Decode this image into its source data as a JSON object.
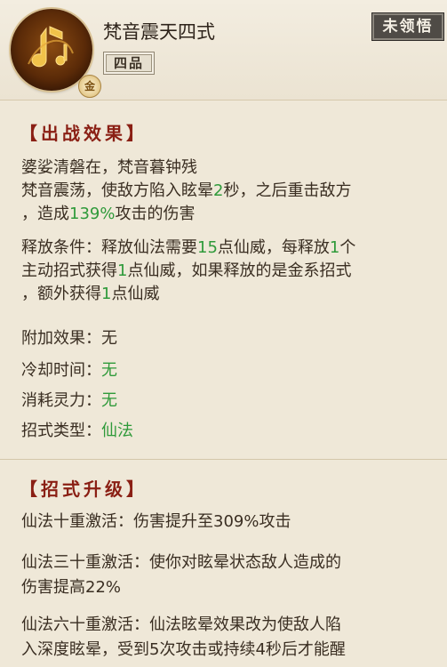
{
  "skill": {
    "name": "梵音震天四式",
    "tier": "四品",
    "state": "未领悟",
    "grade_mark": "金",
    "icon": "golden-music-note-icon"
  },
  "battle": {
    "title": "【出战效果】",
    "verse": "婆娑清磐在，梵音暮钟残",
    "effect": {
      "p1": "梵音震荡，使敌方陷入眩晕",
      "stun_seconds": "2",
      "p2": "秒，之后重击敌方",
      "p3": "，造成",
      "damage_pct": "139%",
      "p4": "攻击的伤害"
    },
    "release": {
      "p1": "释放条件：释放仙法需要",
      "need": "15",
      "p2": "点仙威，每释放",
      "each": "1",
      "p3": "个",
      "p4": "主动招式获得",
      "gain": "1",
      "p5": "点仙威，如果释放的是金系招式",
      "p6": "，额外获得",
      "extra": "1",
      "p7": "点仙威"
    },
    "extra_label": "附加效果：",
    "extra_value": "无",
    "cooldown_label": "冷却时间：",
    "cooldown_value": "无",
    "cost_label": "消耗灵力：",
    "cost_value": "无",
    "type_label": "招式类型：",
    "type_value": "仙法"
  },
  "upgrade": {
    "title": "【招式升级】",
    "lines": [
      "仙法十重激活：伤害提升至309%攻击",
      "仙法三十重激活：使你对眩晕状态敌人造成的",
      "伤害提高22%",
      "仙法六十重激活：仙法眩晕效果改为使敌人陷",
      "入深度眩晕，受到5次攻击或持续4秒后才能醒"
    ]
  },
  "colors": {
    "highlight": "#2f9a3a",
    "section_title": "#8a1f14",
    "background": "#efe8d8"
  }
}
